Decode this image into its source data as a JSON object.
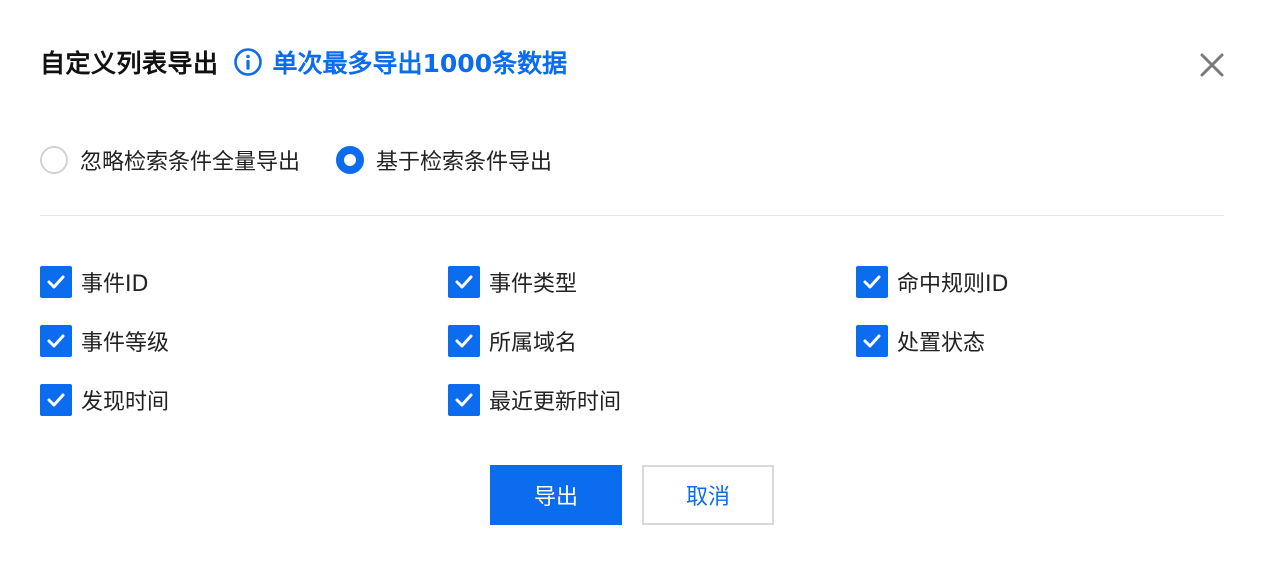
{
  "dialog": {
    "title": "自定义列表导出",
    "info_icon": "info-circle-icon",
    "info_text": "单次最多导出1000条数据",
    "close_icon": "close-icon",
    "accent_color": "#0b6cf0"
  },
  "export_scope": {
    "options": [
      {
        "label": "忽略检索条件全量导出",
        "checked": false
      },
      {
        "label": "基于检索条件导出",
        "checked": true
      }
    ]
  },
  "fields": {
    "items": [
      {
        "label": "事件ID",
        "checked": true
      },
      {
        "label": "事件类型",
        "checked": true
      },
      {
        "label": "命中规则ID",
        "checked": true
      },
      {
        "label": "事件等级",
        "checked": true
      },
      {
        "label": "所属域名",
        "checked": true
      },
      {
        "label": "处置状态",
        "checked": true
      },
      {
        "label": "发现时间",
        "checked": true
      },
      {
        "label": "最近更新时间",
        "checked": true
      }
    ]
  },
  "actions": {
    "export_label": "导出",
    "cancel_label": "取消"
  }
}
